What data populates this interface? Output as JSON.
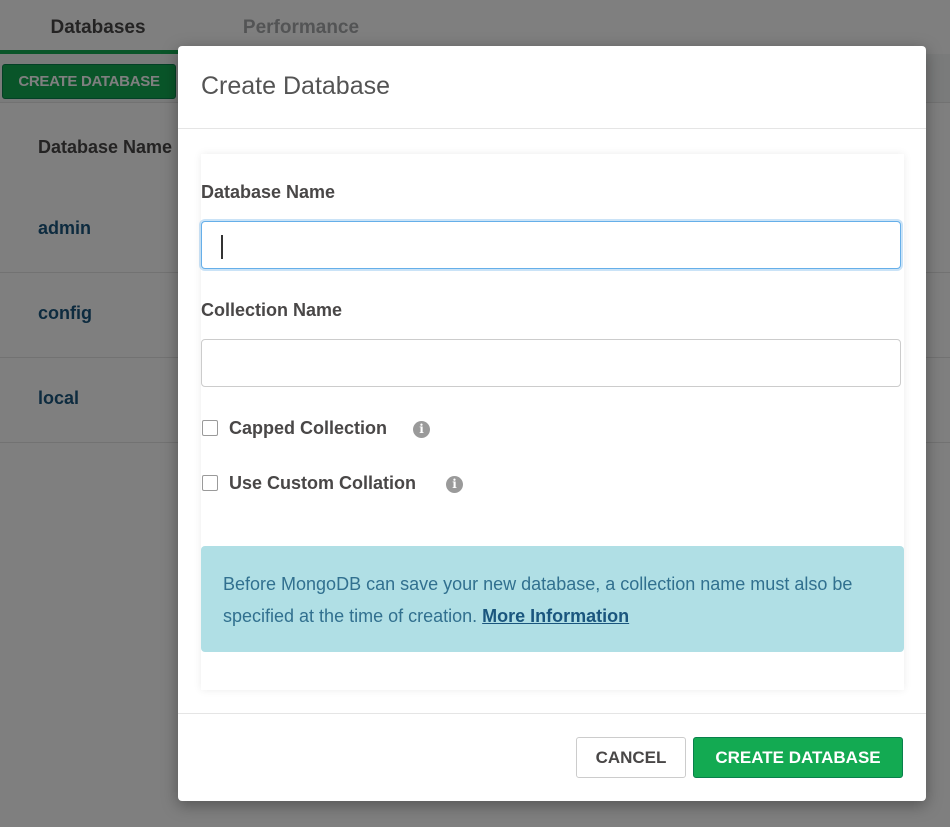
{
  "tabs": {
    "databases": "Databases",
    "performance": "Performance"
  },
  "toolbar": {
    "create_database": "CREATE DATABASE"
  },
  "table": {
    "header": "Database Name",
    "rows": [
      "admin",
      "config",
      "local"
    ]
  },
  "modal": {
    "title": "Create Database",
    "database_name_label": "Database Name",
    "database_name_value": "",
    "collection_name_label": "Collection Name",
    "collection_name_value": "",
    "capped_collection_label": "Capped Collection",
    "custom_collation_label": "Use Custom Collation",
    "info_text": "Before MongoDB can save your new database, a collection name must also be specified at the time of creation.",
    "info_link": "More Information",
    "cancel_label": "CANCEL",
    "submit_label": "CREATE DATABASE"
  },
  "colors": {
    "accent_green": "#13aa52",
    "link_blue": "#1a567e",
    "info_bg": "#b0dfe5",
    "info_text": "#31708f"
  },
  "icons": {
    "info": "info-circle-icon"
  }
}
